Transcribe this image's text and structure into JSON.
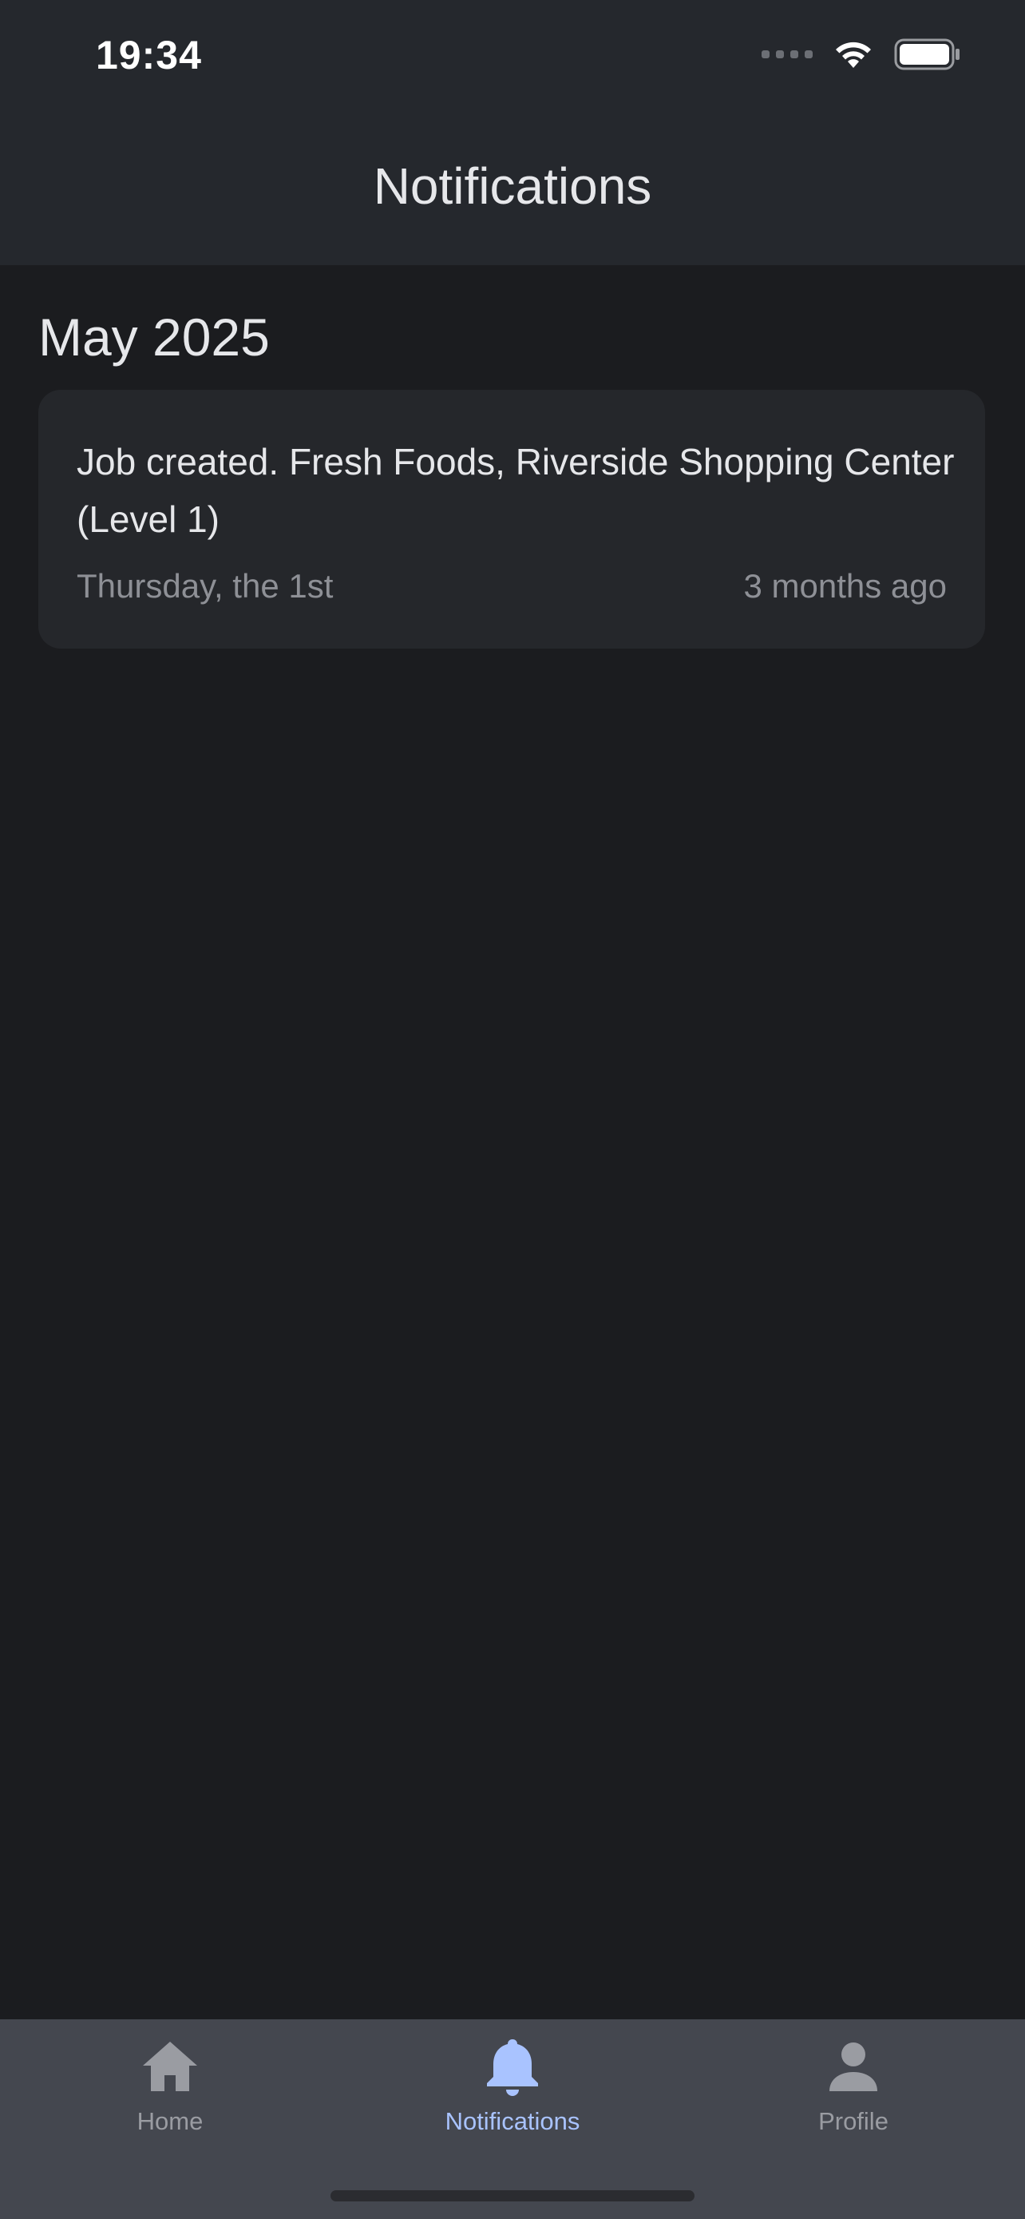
{
  "status_bar": {
    "time": "19:34"
  },
  "header": {
    "title": "Notifications"
  },
  "notifications": {
    "sections": [
      {
        "heading": "May 2025",
        "items": [
          {
            "message": "Job created. Fresh Foods, Riverside Shopping Center (Level 1)",
            "date": "Thursday, the 1st",
            "relative_time": "3 months ago"
          }
        ]
      }
    ]
  },
  "tab_bar": {
    "items": [
      {
        "label": "Home",
        "icon": "home-icon",
        "active": false
      },
      {
        "label": "Notifications",
        "icon": "bell-icon",
        "active": true
      },
      {
        "label": "Profile",
        "icon": "person-icon",
        "active": false
      }
    ]
  },
  "colors": {
    "background": "#1b1c1f",
    "header": "#25282d",
    "card": "#25272b",
    "tab_bar": "#44474f",
    "accent": "#a9c3ff",
    "muted_text": "#8e9096"
  }
}
